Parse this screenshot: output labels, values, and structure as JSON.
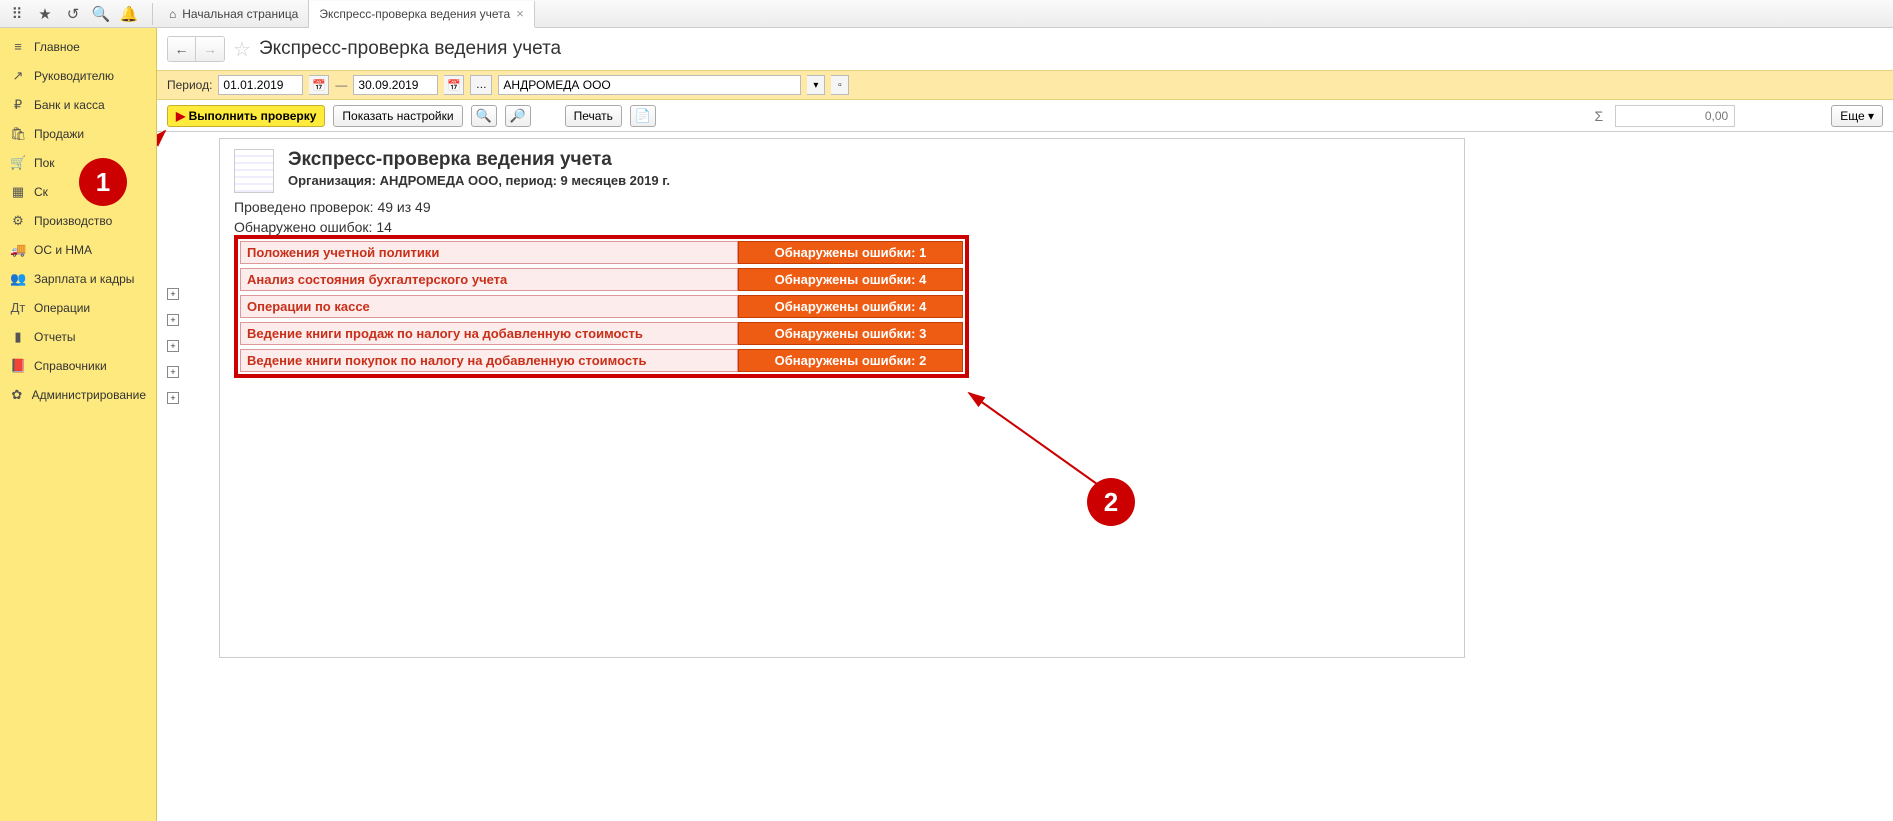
{
  "tabs": {
    "home": "Начальная страница",
    "current": "Экспресс-проверка ведения учета"
  },
  "sidebar": [
    {
      "icon": "≡",
      "label": "Главное"
    },
    {
      "icon": "↗",
      "label": "Руководителю"
    },
    {
      "icon": "₽",
      "label": "Банк и касса"
    },
    {
      "icon": "🛍",
      "label": "Продажи"
    },
    {
      "icon": "🛒",
      "label": "Пок"
    },
    {
      "icon": "▦",
      "label": "Ск"
    },
    {
      "icon": "⚙",
      "label": "Производство"
    },
    {
      "icon": "🚚",
      "label": "ОС и НМА"
    },
    {
      "icon": "👥",
      "label": "Зарплата и кадры"
    },
    {
      "icon": "Дт",
      "label": "Операции"
    },
    {
      "icon": "▮",
      "label": "Отчеты"
    },
    {
      "icon": "📕",
      "label": "Справочники"
    },
    {
      "icon": "✿",
      "label": "Администрирование"
    }
  ],
  "page": {
    "title": "Экспресс-проверка ведения учета"
  },
  "filters": {
    "period_label": "Период:",
    "date_from": "01.01.2019",
    "date_to": "30.09.2019",
    "org": "АНДРОМЕДА ООО"
  },
  "toolbar": {
    "run": "Выполнить проверку",
    "settings": "Показать настройки",
    "print": "Печать",
    "more": "Еще",
    "sumvalue": "0,00"
  },
  "report": {
    "title": "Экспресс-проверка ведения учета",
    "subtitle": "Организация: АНДРОМЕДА ООО, период: 9 месяцев 2019 г.",
    "checks": "Проведено проверок: 49 из 49",
    "errors": "Обнаружено ошибок: 14"
  },
  "results": [
    {
      "name": "Положения учетной политики",
      "err": "Обнаружены ошибки: 1"
    },
    {
      "name": "Анализ состояния бухгалтерского учета",
      "err": "Обнаружены ошибки: 4"
    },
    {
      "name": "Операции по кассе",
      "err": "Обнаружены ошибки: 4"
    },
    {
      "name": "Ведение книги продаж по налогу на добавленную стоимость",
      "err": "Обнаружены ошибки: 3"
    },
    {
      "name": "Ведение книги покупок по налогу на добавленную стоимость",
      "err": "Обнаружены ошибки: 2"
    }
  ],
  "markers": {
    "m1": "1",
    "m2": "2"
  }
}
